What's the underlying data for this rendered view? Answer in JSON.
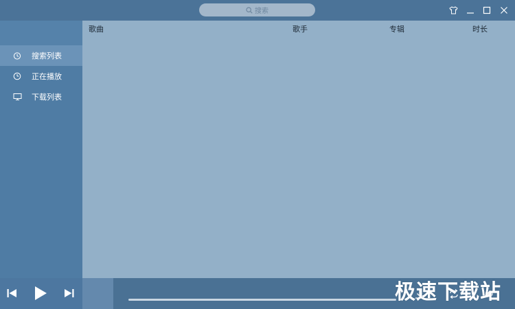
{
  "search": {
    "placeholder": "搜索",
    "icon": "search-icon"
  },
  "window_controls": [
    "skin-icon",
    "minimize-icon",
    "maximize-icon",
    "close-icon"
  ],
  "sidebar": {
    "items": [
      {
        "label": "搜索列表",
        "icon": "stopwatch-icon",
        "active": true
      },
      {
        "label": "正在播放",
        "icon": "clock-icon",
        "active": false
      },
      {
        "label": "下载列表",
        "icon": "monitor-icon",
        "active": false
      }
    ]
  },
  "table": {
    "columns": [
      "歌曲",
      "歌手",
      "专辑",
      "时长"
    ],
    "rows": []
  },
  "player": {
    "controls": [
      "previous-icon",
      "play-icon",
      "next-icon"
    ],
    "right_icons": [
      "download-icon",
      "repeat-icon",
      "volume-icon"
    ]
  },
  "watermark": "极速下载站",
  "colors": {
    "titlebar": "#4b7398",
    "sidebar": "#4f7ca4",
    "sidebar_active": "#6b93b8",
    "content": "#93b0c8",
    "playerbar": "#4a7194"
  }
}
